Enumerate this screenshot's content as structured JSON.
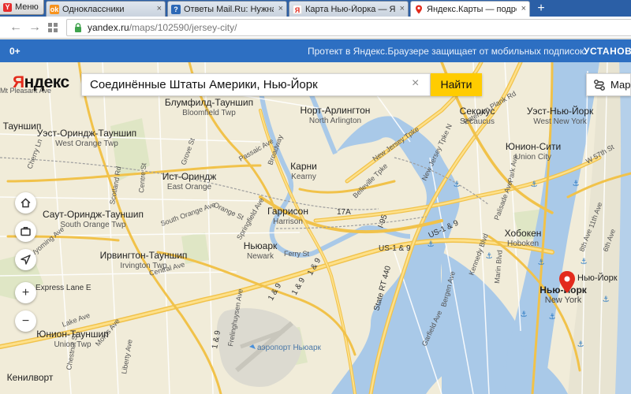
{
  "browser": {
    "menu_label": "Меню",
    "tabs": [
      {
        "label": "Одноклассники",
        "favicon_color": "#f7931e",
        "favicon_glyph": "ok",
        "active": false
      },
      {
        "label": "Ответы Mail.Ru: Нужна пр",
        "favicon_color": "#2c68b6",
        "favicon_glyph": "?",
        "active": false
      },
      {
        "label": "Карта Нью-Йорка — Янде",
        "favicon_color": "#e32b1c",
        "favicon_glyph": "Я",
        "active": false
      },
      {
        "label": "Яндекс.Карты — подробн",
        "favicon_color": "#e32b1c",
        "favicon_glyph": "pin",
        "active": true
      }
    ],
    "new_tab_label": "+",
    "url_domain": "yandex.ru",
    "url_path": "/maps/102590/jersey-city/"
  },
  "promo": {
    "count": "0+",
    "text": "Протект в Яндекс.Браузере защищает от мобильных подписок",
    "install_label": "УСТАНОВ"
  },
  "search": {
    "logo_first": "Я",
    "logo_rest": "ндекс",
    "query": "Соединённые Штаты Америки, Нью-Йорк",
    "clear_icon": "×",
    "button_label": "Найти",
    "routes_label": "Марш"
  },
  "controls": {
    "home_icon": "house-icon",
    "traffic_icon": "briefcase-icon",
    "locate_icon": "arrow-icon",
    "zoom_in": "+",
    "zoom_out": "−"
  },
  "map": {
    "marker_label": "Нью-Йорк",
    "places": [
      {
        "ru": "Блумфилд-Тауншип",
        "en": "Bloomfield Twp"
      },
      {
        "ru": "Норт-Арлингтон",
        "en": "North Arlington"
      },
      {
        "ru": "Секокус",
        "en": "Secaucus"
      },
      {
        "ru": "Уэст-Нью-Йорк",
        "en": "West New York"
      },
      {
        "ru": "Юнион-Сити",
        "en": "Union City"
      },
      {
        "ru": "Уэст-Ориндж-Тауншип",
        "en": "West Orange Twp"
      },
      {
        "ru": "Ист-Ориндж",
        "en": "East Orange"
      },
      {
        "ru": "Карни",
        "en": "Kearny"
      },
      {
        "ru": "Гаррисон",
        "en": "Harrison"
      },
      {
        "ru": "Саут-Ориндж-Тауншип",
        "en": "South Orange Twp"
      },
      {
        "ru": "Хобокен",
        "en": "Hoboken"
      },
      {
        "ru": "Ирвингтон-Тауншип",
        "en": "Irvington Twp"
      },
      {
        "ru": "Ньюарк",
        "en": "Newark"
      },
      {
        "ru": "Нью-Йорк",
        "en": "New York"
      },
      {
        "ru": "Юнион-Тауншип",
        "en": "Union Twp"
      },
      {
        "ru": "Кенилворт",
        "en": "Kenilworth"
      },
      {
        "ru": "Тауншип",
        "en": ""
      }
    ],
    "streets": [
      "Bloomfield Ave",
      "Grove St",
      "Broadway",
      "Centre St",
      "Orange St",
      "South Orange Ave",
      "Springfield Ave",
      "Scotland Rd",
      "Central Ave",
      "Harrison Ave",
      "Ferry St",
      "Passaic Ave",
      "Belleville Tpke",
      "New Jersey Tpke",
      "New Jersey Tpke N",
      "Paterson Plank Rd",
      "Palisade Ave",
      "Park Ave",
      "Marin Blvd",
      "Garfield Ave",
      "Bergen Ave",
      "Kennedy Blvd",
      "W 57th St",
      "11th Ave",
      "6th Ave",
      "8th Ave",
      "E",
      "Frelinghuysen Ave",
      "Wyoming Ave",
      "Cherry Ln",
      "Chestnut St",
      "Morris Ave",
      "Liberty Ave",
      "W 8th St",
      "Lake Ave",
      "Park Pl",
      "Grove Ave"
    ],
    "routes": [
      "I-78 Express Lane E",
      "US-1 & 9",
      "US-1 & 9",
      "I-95",
      "1 & 9",
      "State RT 440",
      "17A",
      "I-95",
      "I-278"
    ],
    "airport": "аэропорт Ньюарк"
  }
}
